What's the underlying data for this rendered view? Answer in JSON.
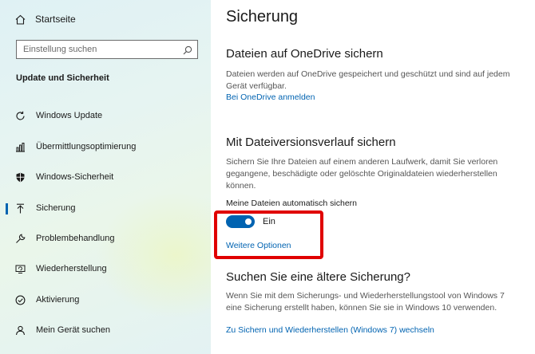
{
  "sidebar": {
    "home_label": "Startseite",
    "search_placeholder": "Einstellung suchen",
    "section_title": "Update und Sicherheit",
    "items": [
      {
        "label": "Windows Update"
      },
      {
        "label": "Übermittlungsoptimierung"
      },
      {
        "label": "Windows-Sicherheit"
      },
      {
        "label": "Sicherung"
      },
      {
        "label": "Problembehandlung"
      },
      {
        "label": "Wiederherstellung"
      },
      {
        "label": "Aktivierung"
      },
      {
        "label": "Mein Gerät suchen"
      }
    ],
    "active_item": "Sicherung"
  },
  "main": {
    "title": "Sicherung",
    "onedrive": {
      "heading": "Dateien auf OneDrive sichern",
      "desc": "Dateien werden auf OneDrive gespeichert und geschützt und sind auf jedem Gerät verfügbar.",
      "link": "Bei OneDrive anmelden"
    },
    "history": {
      "heading": "Mit Dateiversionsverlauf sichern",
      "desc": "Sichern Sie Ihre Dateien auf einem anderen Laufwerk, damit Sie verloren gegangene, beschädigte oder gelöschte Originaldateien wiederherstellen können.",
      "toggle_label": "Meine Dateien automatisch sichern",
      "toggle_state": "Ein",
      "toggle_on": true,
      "more_link": "Weitere Optionen"
    },
    "older": {
      "heading": "Suchen Sie eine ältere Sicherung?",
      "desc": "Wenn Sie mit dem Sicherungs- und Wiederherstellungstool von Windows 7 eine Sicherung erstellt haben, können Sie sie in Windows 10 verwenden.",
      "link": "Zu Sichern und Wiederherstellen (Windows 7) wechseln"
    }
  },
  "colors": {
    "accent": "#0063b1",
    "highlight": "#e00000"
  }
}
